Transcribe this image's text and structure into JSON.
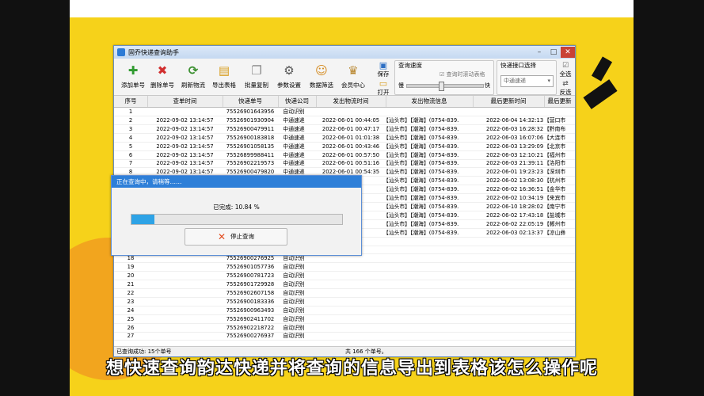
{
  "window": {
    "title": "固乔快递查询助手"
  },
  "toolbar": {
    "buttons": [
      {
        "label": "添加单号",
        "glyph": "✚",
        "color": "#2f9a2f"
      },
      {
        "label": "删除单号",
        "glyph": "✖",
        "color": "#d12f2f"
      },
      {
        "label": "刷新物流",
        "glyph": "⟳",
        "color": "#3a8f2f"
      },
      {
        "label": "导出表格",
        "glyph": "▤",
        "color": "#d79b19"
      },
      {
        "label": "批量复制",
        "glyph": "❐",
        "color": "#888888"
      },
      {
        "label": "参数设置",
        "glyph": "⚙",
        "color": "#555555"
      },
      {
        "label": "数据筛选",
        "glyph": "☺",
        "color": "#d4891c"
      },
      {
        "label": "会员中心",
        "glyph": "♛",
        "color": "#b8862e"
      }
    ],
    "save": "保存",
    "open": "打开",
    "speed": {
      "label": "查询速度",
      "slow": "慢",
      "fast": "快",
      "checkbox": "查询时滚动表格"
    },
    "api": {
      "label": "快递接口选择",
      "value": "中通速递"
    },
    "select_all": "全选",
    "invert": "反选"
  },
  "table": {
    "headers": [
      "序号",
      "查单时间",
      "快递单号",
      "快递公司",
      "发出物流时间",
      "发出物流信息",
      "最后更新时间",
      "最后更新"
    ],
    "rows": [
      {
        "no": "1",
        "time": "",
        "num": "75526901643956",
        "co": "自动识别",
        "st": "",
        "info": "",
        "lt": "",
        "lp": ""
      },
      {
        "no": "2",
        "time": "2022-09-02 13:14:57",
        "num": "75526901930904",
        "co": "中通速递",
        "st": "2022-06-01 00:44:05",
        "info": "【汕头市】【潮海】(0754-839...",
        "lt": "2022-06-04 14:32:13",
        "lp": "【营口市"
      },
      {
        "no": "3",
        "time": "2022-09-02 13:14:57",
        "num": "75526900479911",
        "co": "中通速递",
        "st": "2022-06-01 00:47:17",
        "info": "【汕头市】【潮海】(0754-839...",
        "lt": "2022-06-03 16:28:32",
        "lp": "【黔南布"
      },
      {
        "no": "4",
        "time": "2022-09-02 13:14:57",
        "num": "75526900183818",
        "co": "中通速递",
        "st": "2022-06-01 01:01:38",
        "info": "【汕头市】【潮海】(0754-839...",
        "lt": "2022-06-03 16:07:06",
        "lp": "【大连市"
      },
      {
        "no": "5",
        "time": "2022-09-02 13:14:57",
        "num": "75526901058135",
        "co": "中通速递",
        "st": "2022-06-01 00:43:46",
        "info": "【汕头市】【潮海】(0754-839...",
        "lt": "2022-06-03 13:29:09",
        "lp": "【北京市"
      },
      {
        "no": "6",
        "time": "2022-09-02 13:14:57",
        "num": "75526899988411",
        "co": "中通速递",
        "st": "2022-06-01 00:57:50",
        "info": "【汕头市】【潮海】(0754-839...",
        "lt": "2022-06-03 12:10:21",
        "lp": "【福州市"
      },
      {
        "no": "7",
        "time": "2022-09-02 13:14:57",
        "num": "75526902219573",
        "co": "中通速递",
        "st": "2022-06-01 00:51:16",
        "info": "【汕头市】【潮海】(0754-839...",
        "lt": "2022-06-03 21:39:11",
        "lp": "【洛阳市"
      },
      {
        "no": "8",
        "time": "2022-09-02 13:14:57",
        "num": "75526900479820",
        "co": "中通速递",
        "st": "2022-06-01 00:54:35",
        "info": "【汕头市】【潮海】(0754-839...",
        "lt": "2022-06-01 19:23:23",
        "lp": "【深圳市"
      },
      {
        "no": "",
        "time": "",
        "num": "",
        "co": "",
        "st": "54:29",
        "info": "【汕头市】【潮海】(0754-839...",
        "lt": "2022-06-02 13:08:30",
        "lp": "【杭州市"
      },
      {
        "no": "",
        "time": "",
        "num": "",
        "co": "",
        "st": "54:45",
        "info": "【汕头市】【潮海】(0754-839...",
        "lt": "2022-06-02 16:36:51",
        "lp": "【金华市"
      },
      {
        "no": "",
        "time": "",
        "num": "",
        "co": "",
        "st": "57:42",
        "info": "【汕头市】【潮海】(0754-839...",
        "lt": "2022-06-02 10:34:19",
        "lp": "【来宾市"
      },
      {
        "no": "",
        "time": "",
        "num": "",
        "co": "",
        "st": "56:39",
        "info": "【汕头市】【潮海】(0754-839...",
        "lt": "2022-06-10 18:28:02",
        "lp": "【南宁市"
      },
      {
        "no": "",
        "time": "",
        "num": "",
        "co": "",
        "st": "51:07",
        "info": "【汕头市】【潮海】(0754-839...",
        "lt": "2022-06-02 17:43:18",
        "lp": "【盐城市"
      },
      {
        "no": "",
        "time": "",
        "num": "",
        "co": "",
        "st": "01:39",
        "info": "【汕头市】【潮海】(0754-839...",
        "lt": "2022-06-02 22:05:19",
        "lp": "【郴州市"
      },
      {
        "no": "",
        "time": "",
        "num": "",
        "co": "",
        "st": "47:22",
        "info": "【汕头市】【潮海】(0754-839...",
        "lt": "2022-06-03 02:13:37",
        "lp": "【凉山彝"
      },
      {
        "no": "",
        "time": "",
        "num": "",
        "co": "",
        "st": "",
        "info": "",
        "lt": "",
        "lp": ""
      },
      {
        "no": "",
        "time": "",
        "num": "",
        "co": "",
        "st": "",
        "info": "",
        "lt": "",
        "lp": ""
      },
      {
        "no": "18",
        "time": "",
        "num": "75526900276925",
        "co": "自动识别",
        "st": "",
        "info": "",
        "lt": "",
        "lp": ""
      },
      {
        "no": "19",
        "time": "",
        "num": "75526901057736",
        "co": "自动识别",
        "st": "",
        "info": "",
        "lt": "",
        "lp": ""
      },
      {
        "no": "20",
        "time": "",
        "num": "75526900781723",
        "co": "自动识别",
        "st": "",
        "info": "",
        "lt": "",
        "lp": ""
      },
      {
        "no": "21",
        "time": "",
        "num": "75526901729928",
        "co": "自动识别",
        "st": "",
        "info": "",
        "lt": "",
        "lp": ""
      },
      {
        "no": "22",
        "time": "",
        "num": "75526902607158",
        "co": "自动识别",
        "st": "",
        "info": "",
        "lt": "",
        "lp": ""
      },
      {
        "no": "23",
        "time": "",
        "num": "75526900183336",
        "co": "自动识别",
        "st": "",
        "info": "",
        "lt": "",
        "lp": ""
      },
      {
        "no": "24",
        "time": "",
        "num": "75526900963493",
        "co": "自动识别",
        "st": "",
        "info": "",
        "lt": "",
        "lp": ""
      },
      {
        "no": "25",
        "time": "",
        "num": "75526902411702",
        "co": "自动识别",
        "st": "",
        "info": "",
        "lt": "",
        "lp": ""
      },
      {
        "no": "26",
        "time": "",
        "num": "75526902218722",
        "co": "自动识别",
        "st": "",
        "info": "",
        "lt": "",
        "lp": ""
      },
      {
        "no": "27",
        "time": "",
        "num": "75526900276937",
        "co": "自动识别",
        "st": "",
        "info": "",
        "lt": "",
        "lp": ""
      }
    ]
  },
  "status": {
    "left": "已查询成功: 15个单号",
    "center": "共 166 个单号。"
  },
  "dialog": {
    "title": "正在查询中，请稍等……",
    "percent_text": "已完成: 10.84 %",
    "progress": 0.1084,
    "stop_label": "停止查询"
  },
  "caption": "想快速查询韵达快递并将查询的信息导出到表格该怎么操作呢"
}
